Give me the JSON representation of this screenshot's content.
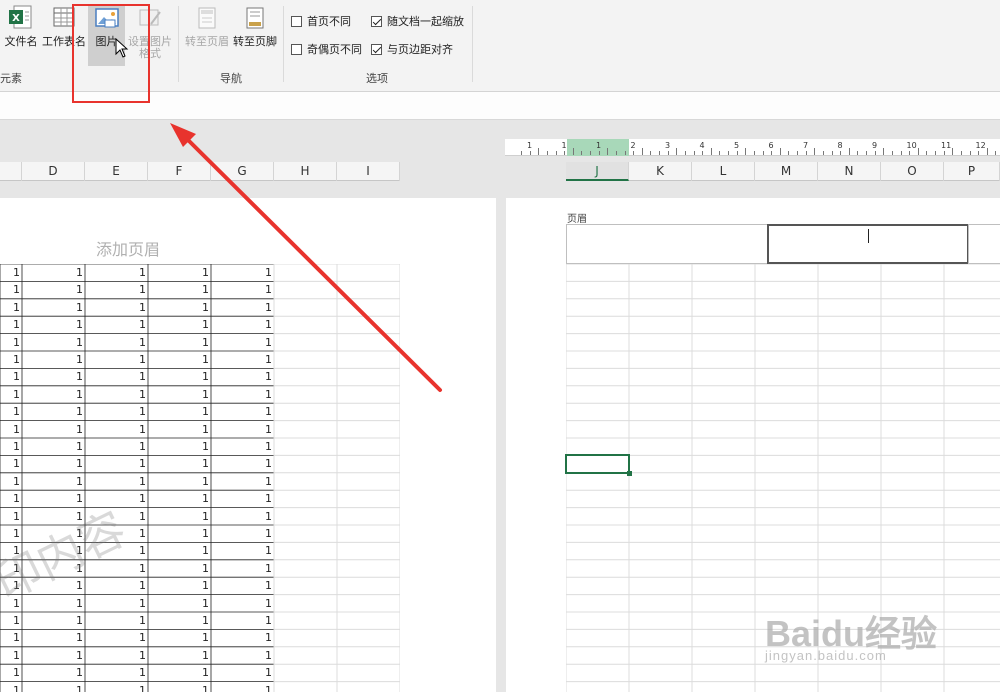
{
  "ribbon": {
    "buttons": {
      "file_name": "文件名",
      "sheet_name": "工作表名",
      "picture": "图片",
      "format_picture": "设置图片格式",
      "goto_header": "转至页眉",
      "goto_footer": "转至页脚"
    },
    "groups": {
      "elements_partial": "元素",
      "navigation": "导航",
      "options": "选项"
    },
    "options": [
      {
        "label": "首页不同",
        "checked": false
      },
      {
        "label": "随文档一起缩放",
        "checked": true
      },
      {
        "label": "奇偶页不同",
        "checked": false
      },
      {
        "label": "与页边距对齐",
        "checked": true
      }
    ]
  },
  "left_page": {
    "columns": [
      "D",
      "E",
      "F",
      "G",
      "H",
      "I"
    ],
    "header_hint": "添加页眉",
    "cell_value": "1",
    "watermark": "印内容"
  },
  "right_page": {
    "columns": [
      "J",
      "K",
      "L",
      "M",
      "N",
      "O",
      "P"
    ],
    "selected_column": "J",
    "header_label": "页眉",
    "ruler_numbers": [
      "1",
      "1",
      "1",
      "2",
      "3",
      "4",
      "5",
      "6",
      "7",
      "8",
      "9",
      "10",
      "11",
      "12"
    ]
  },
  "watermark_brand": {
    "text": "Baidu经验",
    "url": "jingyan.baidu.com"
  },
  "colors": {
    "accent_green": "#217346",
    "annotation_red": "#e8332d"
  }
}
